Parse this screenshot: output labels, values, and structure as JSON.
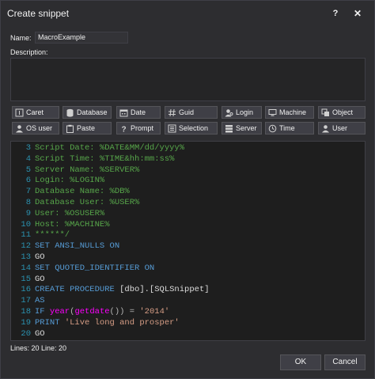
{
  "window": {
    "title": "Create snippet",
    "help_label": "?",
    "close_label": "✕"
  },
  "form": {
    "name_label": "Name:",
    "name_value": "MacroExample",
    "description_label": "Description:",
    "description_value": ""
  },
  "macro_buttons": [
    {
      "label": "Caret",
      "icon": "caret-icon"
    },
    {
      "label": "Database",
      "icon": "database-icon"
    },
    {
      "label": "Date",
      "icon": "calendar-icon"
    },
    {
      "label": "Guid",
      "icon": "hash-icon"
    },
    {
      "label": "Login",
      "icon": "login-icon"
    },
    {
      "label": "Machine",
      "icon": "machine-icon"
    },
    {
      "label": "Object",
      "icon": "object-icon"
    },
    {
      "label": "OS user",
      "icon": "os-user-icon"
    },
    {
      "label": "Paste",
      "icon": "paste-icon"
    },
    {
      "label": "Prompt",
      "icon": "prompt-icon"
    },
    {
      "label": "Selection",
      "icon": "selection-icon"
    },
    {
      "label": "Server",
      "icon": "server-icon"
    },
    {
      "label": "Time",
      "icon": "clock-icon"
    },
    {
      "label": "User",
      "icon": "user-icon"
    }
  ],
  "editor": {
    "lines": [
      {
        "n": "3",
        "tokens": [
          {
            "t": "Script Date: %DATE&MM/dd/yyyy%",
            "c": "comment"
          }
        ]
      },
      {
        "n": "4",
        "tokens": [
          {
            "t": "Script Time: %TIME&hh:mm:ss%",
            "c": "comment"
          }
        ]
      },
      {
        "n": "5",
        "tokens": [
          {
            "t": "Server Name: %SERVER%",
            "c": "comment"
          }
        ]
      },
      {
        "n": "6",
        "tokens": [
          {
            "t": "Login: %LOGIN%",
            "c": "comment"
          }
        ]
      },
      {
        "n": "7",
        "tokens": [
          {
            "t": "Database Name: %DB%",
            "c": "comment"
          }
        ]
      },
      {
        "n": "8",
        "tokens": [
          {
            "t": "Database User: %USER%",
            "c": "comment"
          }
        ]
      },
      {
        "n": "9",
        "tokens": [
          {
            "t": "User: %OSUSER%",
            "c": "comment"
          }
        ]
      },
      {
        "n": "10",
        "tokens": [
          {
            "t": "Host: %MACHINE%",
            "c": "comment"
          }
        ]
      },
      {
        "n": "11",
        "tokens": [
          {
            "t": "******/",
            "c": "comment"
          }
        ]
      },
      {
        "n": "12",
        "tokens": [
          {
            "t": "SET ANSI_NULLS ON",
            "c": "kw"
          }
        ]
      },
      {
        "n": "13",
        "tokens": [
          {
            "t": "GO",
            "c": "plain"
          }
        ]
      },
      {
        "n": "14",
        "tokens": [
          {
            "t": "SET QUOTED_IDENTIFIER ON",
            "c": "kw"
          }
        ]
      },
      {
        "n": "15",
        "tokens": [
          {
            "t": "GO",
            "c": "plain"
          }
        ]
      },
      {
        "n": "16",
        "tokens": [
          {
            "t": "CREATE PROCEDURE ",
            "c": "kw"
          },
          {
            "t": "[dbo].[SQLSnippet]",
            "c": "plain"
          }
        ]
      },
      {
        "n": "17",
        "tokens": [
          {
            "t": "AS",
            "c": "kw"
          }
        ]
      },
      {
        "n": "18",
        "tokens": [
          {
            "t": "IF ",
            "c": "kw"
          },
          {
            "t": "year",
            "c": "fn"
          },
          {
            "t": "(",
            "c": "punct"
          },
          {
            "t": "getdate",
            "c": "fn"
          },
          {
            "t": "()) = ",
            "c": "punct"
          },
          {
            "t": "'2014'",
            "c": "str"
          }
        ]
      },
      {
        "n": "19",
        "tokens": [
          {
            "t": "PRINT ",
            "c": "kw"
          },
          {
            "t": "'Live long and prosper'",
            "c": "str"
          }
        ]
      },
      {
        "n": "20",
        "tokens": [
          {
            "t": "GO",
            "c": "plain"
          }
        ]
      }
    ]
  },
  "status": {
    "text": "Lines: 20 Line: 20"
  },
  "footer": {
    "ok_label": "OK",
    "cancel_label": "Cancel"
  }
}
